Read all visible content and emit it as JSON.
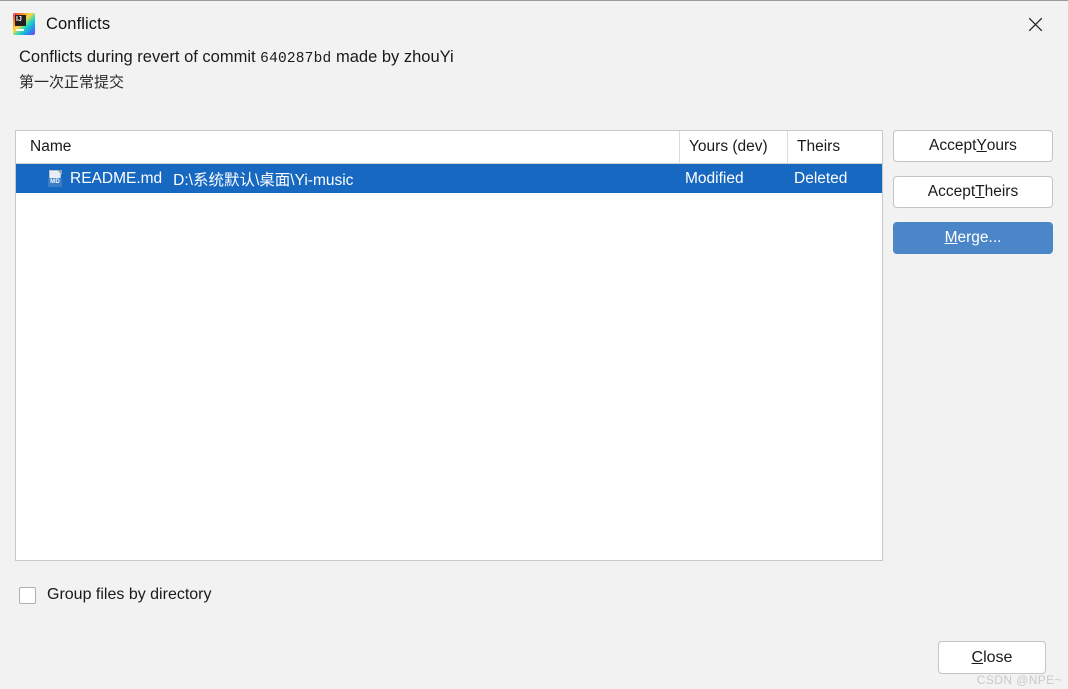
{
  "window": {
    "title": "Conflicts",
    "app_icon": "intellij-idea-icon",
    "close_icon": "close-icon"
  },
  "headline": {
    "prefix": "Conflicts during revert of commit ",
    "commit_hash": "640287bd",
    "suffix": " made by zhouYi",
    "subtitle": "第一次正常提交"
  },
  "table": {
    "columns": [
      {
        "key": "name",
        "label": "Name"
      },
      {
        "key": "yours",
        "label": "Yours (dev)"
      },
      {
        "key": "theirs",
        "label": "Theirs"
      }
    ],
    "rows": [
      {
        "icon": "markdown-file-icon",
        "icon_badge": "MD",
        "name": "README.md",
        "path": "D:\\系统默认\\桌面\\Yi-music",
        "yours": "Modified",
        "theirs": "Deleted",
        "selected": true
      }
    ]
  },
  "side_buttons": [
    {
      "name": "accept-yours-button",
      "pre": "Accept ",
      "mnemonic": "Y",
      "post": "ours",
      "style": "default"
    },
    {
      "name": "accept-theirs-button",
      "pre": "Accept ",
      "mnemonic": "T",
      "post": "heirs",
      "style": "default"
    },
    {
      "name": "merge-button",
      "pre": "",
      "mnemonic": "M",
      "post": "erge...",
      "style": "primary"
    }
  ],
  "options": {
    "group_files_label": "Group files by directory",
    "group_files_checked": false
  },
  "footer": {
    "close_mnemonic": "C",
    "close_rest": "lose",
    "watermark": "CSDN @NPE~"
  },
  "colors": {
    "selection_blue": "#1668c1",
    "primary_button": "#4a86c8",
    "dialog_background": "#f2f2f2",
    "panel_background": "#ffffff"
  }
}
